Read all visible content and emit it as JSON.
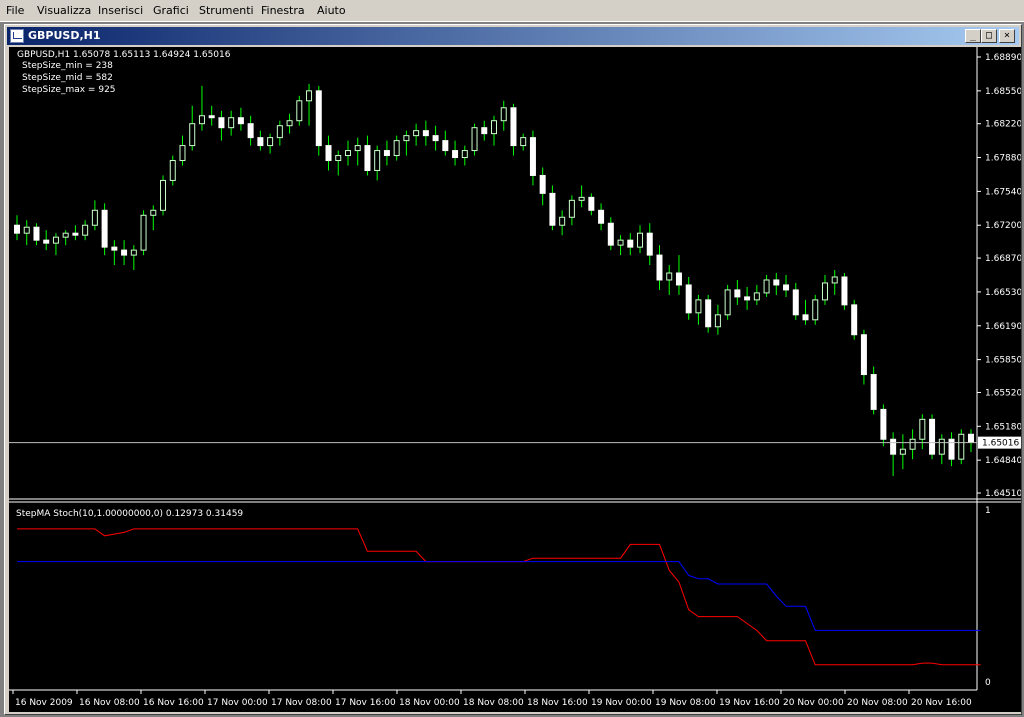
{
  "menu": {
    "items": [
      "File",
      "Visualizza",
      "Inserisci",
      "Grafici",
      "Strumenti",
      "Finestra",
      "Aiuto"
    ]
  },
  "window": {
    "title": "GBPUSD,H1",
    "min_glyph": "_",
    "max_glyph": "□",
    "close_glyph": "×"
  },
  "main_chart": {
    "header": "GBPUSD,H1  1.65078 1.65113 1.64924 1.65016",
    "params": [
      "StepSize_min = 238",
      "StepSize_mid = 582",
      "StepSize_max = 925"
    ],
    "price_ticks": [
      "1.68890",
      "1.68550",
      "1.68220",
      "1.67880",
      "1.67540",
      "1.67200",
      "1.66870",
      "1.66530",
      "1.66190",
      "1.65850",
      "1.65520",
      "1.65180",
      "1.64840",
      "1.64510"
    ],
    "current_price": "1.65016",
    "colors": {
      "bull": "#ccffcc",
      "bear": "#ffffff",
      "wick": "#00ff00",
      "price_line": "#c0c0c0"
    }
  },
  "indicator": {
    "header": "StepMA Stoch(10,1.00000000,0) 0.12973 0.31459",
    "top_label": "1",
    "bottom_label": "0",
    "colors": {
      "red": "#ff0000",
      "blue": "#0000ff"
    }
  },
  "time_axis": {
    "labels": [
      "16 Nov 2009",
      "16 Nov 08:00",
      "16 Nov 16:00",
      "17 Nov 00:00",
      "17 Nov 08:00",
      "17 Nov 16:00",
      "18 Nov 00:00",
      "18 Nov 08:00",
      "18 Nov 16:00",
      "19 Nov 00:00",
      "19 Nov 08:00",
      "19 Nov 16:00",
      "20 Nov 00:00",
      "20 Nov 08:00",
      "20 Nov 16:00"
    ]
  },
  "chart_data": [
    {
      "type": "candlestick",
      "symbol": "GBPUSD",
      "timeframe": "H1",
      "ylim": [
        1.6451,
        1.6889
      ],
      "candles_ohlc": [
        [
          1.672,
          1.673,
          1.6705,
          1.6712
        ],
        [
          1.6712,
          1.6725,
          1.67,
          1.6718
        ],
        [
          1.6718,
          1.6722,
          1.67,
          1.6705
        ],
        [
          1.6705,
          1.6715,
          1.6695,
          1.6702
        ],
        [
          1.6702,
          1.6712,
          1.669,
          1.6708
        ],
        [
          1.6708,
          1.6715,
          1.67,
          1.6712
        ],
        [
          1.6712,
          1.672,
          1.6705,
          1.671
        ],
        [
          1.671,
          1.6725,
          1.6705,
          1.672
        ],
        [
          1.672,
          1.6745,
          1.6715,
          1.6735
        ],
        [
          1.6735,
          1.6742,
          1.669,
          1.6698
        ],
        [
          1.6698,
          1.6705,
          1.668,
          1.6695
        ],
        [
          1.6695,
          1.6705,
          1.668,
          1.669
        ],
        [
          1.669,
          1.67,
          1.6675,
          1.6695
        ],
        [
          1.6695,
          1.6735,
          1.669,
          1.673
        ],
        [
          1.673,
          1.674,
          1.6715,
          1.6735
        ],
        [
          1.6735,
          1.677,
          1.673,
          1.6765
        ],
        [
          1.6765,
          1.679,
          1.676,
          1.6785
        ],
        [
          1.6785,
          1.681,
          1.678,
          1.68
        ],
        [
          1.68,
          1.684,
          1.6795,
          1.6822
        ],
        [
          1.6822,
          1.686,
          1.6815,
          1.683
        ],
        [
          1.683,
          1.684,
          1.682,
          1.6828
        ],
        [
          1.6828,
          1.6835,
          1.6805,
          1.6818
        ],
        [
          1.6818,
          1.6835,
          1.681,
          1.6828
        ],
        [
          1.6828,
          1.6838,
          1.6815,
          1.6822
        ],
        [
          1.6822,
          1.683,
          1.68,
          1.6808
        ],
        [
          1.6808,
          1.6815,
          1.6795,
          1.68
        ],
        [
          1.68,
          1.6812,
          1.6792,
          1.6808
        ],
        [
          1.6808,
          1.6825,
          1.68,
          1.682
        ],
        [
          1.682,
          1.6832,
          1.6812,
          1.6825
        ],
        [
          1.6825,
          1.685,
          1.682,
          1.6845
        ],
        [
          1.6845,
          1.6862,
          1.682,
          1.6855
        ],
        [
          1.6855,
          1.686,
          1.679,
          1.68
        ],
        [
          1.68,
          1.681,
          1.6775,
          1.6785
        ],
        [
          1.6785,
          1.6795,
          1.677,
          1.679
        ],
        [
          1.679,
          1.6805,
          1.678,
          1.6795
        ],
        [
          1.6795,
          1.6808,
          1.678,
          1.68
        ],
        [
          1.68,
          1.681,
          1.677,
          1.6775
        ],
        [
          1.6775,
          1.68,
          1.6765,
          1.6795
        ],
        [
          1.6795,
          1.6805,
          1.678,
          1.679
        ],
        [
          1.679,
          1.681,
          1.6785,
          1.6805
        ],
        [
          1.6805,
          1.6815,
          1.679,
          1.681
        ],
        [
          1.681,
          1.6822,
          1.68,
          1.6815
        ],
        [
          1.6815,
          1.6825,
          1.68,
          1.681
        ],
        [
          1.681,
          1.682,
          1.6795,
          1.6805
        ],
        [
          1.6805,
          1.6815,
          1.679,
          1.6795
        ],
        [
          1.6795,
          1.6805,
          1.678,
          1.6788
        ],
        [
          1.6788,
          1.68,
          1.678,
          1.6795
        ],
        [
          1.6795,
          1.6822,
          1.679,
          1.6818
        ],
        [
          1.6818,
          1.6825,
          1.6805,
          1.6812
        ],
        [
          1.6812,
          1.683,
          1.68,
          1.6825
        ],
        [
          1.6825,
          1.6845,
          1.6815,
          1.6838
        ],
        [
          1.6838,
          1.6842,
          1.679,
          1.68
        ],
        [
          1.68,
          1.6812,
          1.6795,
          1.6808
        ],
        [
          1.6808,
          1.6815,
          1.676,
          1.677
        ],
        [
          1.677,
          1.6778,
          1.674,
          1.6752
        ],
        [
          1.6752,
          1.676,
          1.6715,
          1.672
        ],
        [
          1.672,
          1.6735,
          1.671,
          1.6728
        ],
        [
          1.6728,
          1.675,
          1.672,
          1.6745
        ],
        [
          1.6745,
          1.676,
          1.6738,
          1.6748
        ],
        [
          1.6748,
          1.6752,
          1.673,
          1.6735
        ],
        [
          1.6735,
          1.6742,
          1.6715,
          1.6722
        ],
        [
          1.6722,
          1.6728,
          1.6695,
          1.67
        ],
        [
          1.67,
          1.671,
          1.669,
          1.6705
        ],
        [
          1.6705,
          1.6712,
          1.669,
          1.6698
        ],
        [
          1.6698,
          1.672,
          1.6692,
          1.6712
        ],
        [
          1.6712,
          1.6722,
          1.668,
          1.669
        ],
        [
          1.669,
          1.67,
          1.6655,
          1.6665
        ],
        [
          1.6665,
          1.668,
          1.665,
          1.6672
        ],
        [
          1.6672,
          1.669,
          1.665,
          1.666
        ],
        [
          1.666,
          1.6668,
          1.6625,
          1.6632
        ],
        [
          1.6632,
          1.665,
          1.662,
          1.6645
        ],
        [
          1.6645,
          1.665,
          1.6612,
          1.6618
        ],
        [
          1.6618,
          1.664,
          1.661,
          1.663
        ],
        [
          1.663,
          1.666,
          1.6625,
          1.6655
        ],
        [
          1.6655,
          1.6665,
          1.664,
          1.6648
        ],
        [
          1.6648,
          1.6658,
          1.6635,
          1.6645
        ],
        [
          1.6645,
          1.666,
          1.664,
          1.6652
        ],
        [
          1.6652,
          1.667,
          1.6648,
          1.6665
        ],
        [
          1.6665,
          1.6672,
          1.665,
          1.666
        ],
        [
          1.666,
          1.667,
          1.6648,
          1.6655
        ],
        [
          1.6655,
          1.6662,
          1.6625,
          1.663
        ],
        [
          1.663,
          1.6645,
          1.662,
          1.6625
        ],
        [
          1.6625,
          1.665,
          1.662,
          1.6645
        ],
        [
          1.6645,
          1.667,
          1.664,
          1.6662
        ],
        [
          1.6662,
          1.6675,
          1.665,
          1.6668
        ],
        [
          1.6668,
          1.6672,
          1.6635,
          1.664
        ],
        [
          1.664,
          1.6645,
          1.6605,
          1.661
        ],
        [
          1.661,
          1.6615,
          1.656,
          1.657
        ],
        [
          1.657,
          1.6578,
          1.653,
          1.6535
        ],
        [
          1.6535,
          1.654,
          1.6498,
          1.6505
        ],
        [
          1.6505,
          1.6512,
          1.6468,
          1.649
        ],
        [
          1.649,
          1.651,
          1.6475,
          1.6495
        ],
        [
          1.6495,
          1.6515,
          1.6485,
          1.6505
        ],
        [
          1.6505,
          1.653,
          1.6495,
          1.6525
        ],
        [
          1.6525,
          1.653,
          1.6485,
          1.649
        ],
        [
          1.649,
          1.651,
          1.648,
          1.6505
        ],
        [
          1.6505,
          1.6512,
          1.6478,
          1.6485
        ],
        [
          1.6485,
          1.6515,
          1.648,
          1.651
        ],
        [
          1.651,
          1.6515,
          1.6492,
          1.6502
        ]
      ]
    },
    {
      "type": "line",
      "title": "StepMA Stoch(10,1.00000000,0)",
      "ylim": [
        0,
        1
      ],
      "series": [
        {
          "name": "red",
          "color": "#ff0000",
          "values": [
            0.89,
            0.89,
            0.89,
            0.89,
            0.89,
            0.89,
            0.89,
            0.89,
            0.89,
            0.85,
            0.86,
            0.87,
            0.89,
            0.89,
            0.89,
            0.89,
            0.89,
            0.89,
            0.89,
            0.89,
            0.89,
            0.89,
            0.89,
            0.89,
            0.89,
            0.89,
            0.89,
            0.89,
            0.89,
            0.89,
            0.89,
            0.89,
            0.89,
            0.89,
            0.89,
            0.89,
            0.76,
            0.76,
            0.76,
            0.76,
            0.76,
            0.76,
            0.7,
            0.7,
            0.7,
            0.7,
            0.7,
            0.7,
            0.7,
            0.7,
            0.7,
            0.7,
            0.7,
            0.72,
            0.72,
            0.72,
            0.72,
            0.72,
            0.72,
            0.72,
            0.72,
            0.72,
            0.72,
            0.8,
            0.8,
            0.8,
            0.8,
            0.65,
            0.58,
            0.42,
            0.38,
            0.38,
            0.38,
            0.38,
            0.38,
            0.34,
            0.3,
            0.24,
            0.24,
            0.24,
            0.24,
            0.24,
            0.1,
            0.1,
            0.1,
            0.1,
            0.1,
            0.1,
            0.1,
            0.1,
            0.1,
            0.1,
            0.1,
            0.11,
            0.11,
            0.1,
            0.1,
            0.1,
            0.1,
            0.1
          ]
        },
        {
          "name": "blue",
          "color": "#0000ff",
          "values": [
            0.7,
            0.7,
            0.7,
            0.7,
            0.7,
            0.7,
            0.7,
            0.7,
            0.7,
            0.7,
            0.7,
            0.7,
            0.7,
            0.7,
            0.7,
            0.7,
            0.7,
            0.7,
            0.7,
            0.7,
            0.7,
            0.7,
            0.7,
            0.7,
            0.7,
            0.7,
            0.7,
            0.7,
            0.7,
            0.7,
            0.7,
            0.7,
            0.7,
            0.7,
            0.7,
            0.7,
            0.7,
            0.7,
            0.7,
            0.7,
            0.7,
            0.7,
            0.7,
            0.7,
            0.7,
            0.7,
            0.7,
            0.7,
            0.7,
            0.7,
            0.7,
            0.7,
            0.7,
            0.7,
            0.7,
            0.7,
            0.7,
            0.7,
            0.7,
            0.7,
            0.7,
            0.7,
            0.7,
            0.7,
            0.7,
            0.7,
            0.7,
            0.7,
            0.7,
            0.62,
            0.6,
            0.6,
            0.57,
            0.57,
            0.57,
            0.57,
            0.57,
            0.57,
            0.5,
            0.44,
            0.44,
            0.44,
            0.3,
            0.3,
            0.3,
            0.3,
            0.3,
            0.3,
            0.3,
            0.3,
            0.3,
            0.3,
            0.3,
            0.3,
            0.3,
            0.3,
            0.3,
            0.3,
            0.3,
            0.3
          ]
        }
      ]
    }
  ]
}
